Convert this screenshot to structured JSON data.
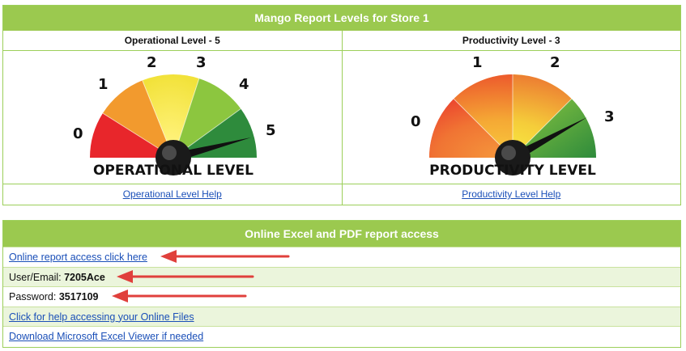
{
  "levels_panel": {
    "title": "Mango Report Levels for Store 1",
    "operational": {
      "title": "Operational Level - 5",
      "level": 5,
      "ticks": [
        "0",
        "1",
        "2",
        "3",
        "4",
        "5"
      ],
      "gauge_label": "OPERATIONAL LEVEL",
      "help_link": "Operational Level Help"
    },
    "productivity": {
      "title": "Productivity Level - 3",
      "level": 3,
      "ticks": [
        "0",
        "1",
        "2",
        "3"
      ],
      "gauge_label": "PRODUCTIVITY LEVEL",
      "help_link": "Productivity Level Help"
    }
  },
  "access_panel": {
    "title": "Online Excel and PDF report access",
    "report_link": "Online report access click here",
    "user_label": "User/Email:",
    "user_value": "7205Ace",
    "password_label": "Password:",
    "password_value": "3517109",
    "help_link": "Click for help accessing your Online Files",
    "viewer_link": "Download Microsoft Excel Viewer if needed"
  },
  "colors": {
    "header_green": "#9bc94f",
    "row_shade": "#ebf5dc",
    "link_blue": "#1a4fb8",
    "arrow_red": "#e0403c",
    "gauge_red": "#e8262b",
    "gauge_orange": "#f29a2e",
    "gauge_yellow": "#f2e93a",
    "gauge_lightgreen": "#8cc63f",
    "gauge_darkgreen": "#2e8b3c"
  }
}
